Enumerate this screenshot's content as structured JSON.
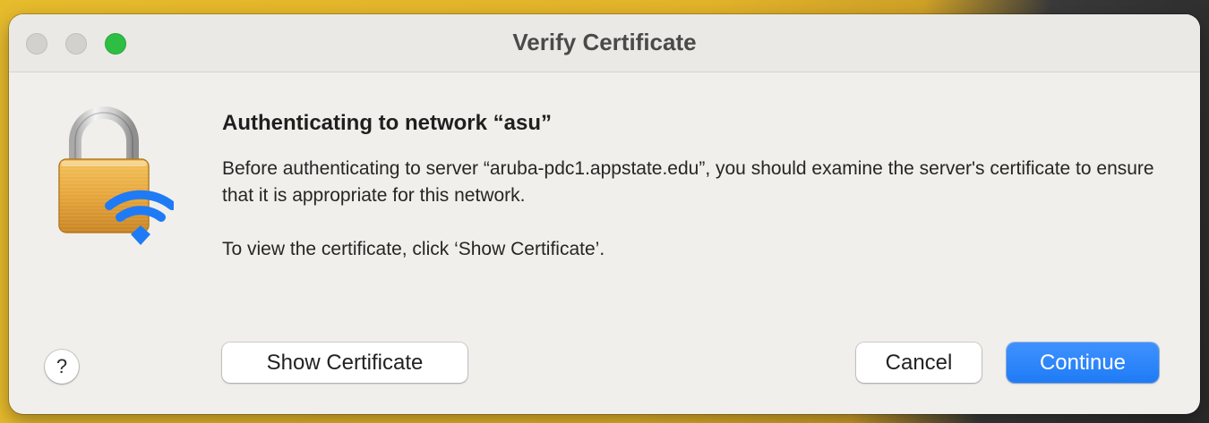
{
  "window": {
    "title": "Verify Certificate"
  },
  "icon": {
    "name": "lock-wifi-icon",
    "lock_color": "#e6a53a",
    "wifi_color": "#1f7bf5"
  },
  "dialog": {
    "heading": "Authenticating to network “asu”",
    "message": "Before authenticating to server “aruba-pdc1.appstate.edu”, you should examine the server's certificate to ensure that it is appropriate for this network.",
    "hint": "To view the certificate, click ‘Show Certificate’."
  },
  "buttons": {
    "help": "?",
    "show_certificate": "Show Certificate",
    "cancel": "Cancel",
    "continue": "Continue"
  },
  "colors": {
    "accent": "#1f7bf5",
    "zoom_button": "#2fbe44"
  }
}
